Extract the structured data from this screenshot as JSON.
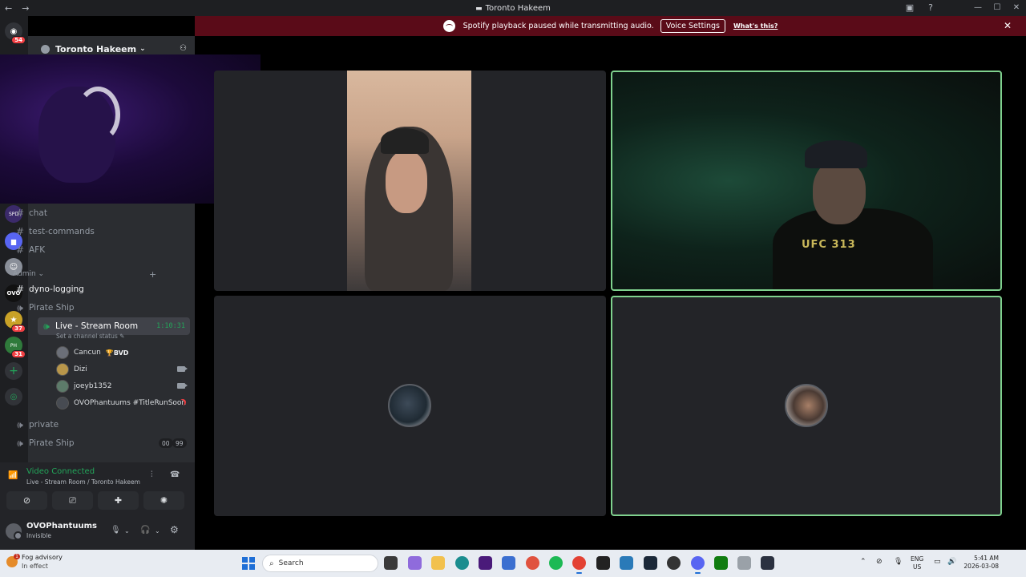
{
  "window": {
    "title": "Toronto Hakeem",
    "controls": [
      "—",
      "☐",
      "✕"
    ]
  },
  "banner": {
    "message": "Spotify playback paused while transmitting audio.",
    "button_label": "Voice Settings",
    "link_label": "What's this?"
  },
  "rail": {
    "badges": [
      "54",
      "37",
      "31"
    ]
  },
  "server": {
    "name": "Toronto Hakeem"
  },
  "channels": {
    "text1": "chat",
    "text2": "test-commands",
    "text3": "AFK",
    "category_admin": "Admin",
    "dyno": "dyno-logging",
    "pirate1": "Pirate Ship",
    "live": "Live - Stream Room",
    "live_timer": "1:10:31",
    "live_status": "Set a channel status",
    "private": "private",
    "pirate2": "Pirate Ship",
    "pirate2_count_a": "00",
    "pirate2_count_b": "99"
  },
  "voice_users": [
    {
      "name": "Cancun",
      "tag": "🏆BVD"
    },
    {
      "name": "Dizi"
    },
    {
      "name": "joeyb1352"
    },
    {
      "name": "OVOPhantuums #TitleRunSoon"
    }
  ],
  "voice_panel": {
    "status": "Video Connected",
    "location": "Live - Stream Room / Toronto Hakeem"
  },
  "user": {
    "name": "OVOPhantuums",
    "status": "Invisible"
  },
  "video": {
    "jersey_text": "UFC 313"
  },
  "taskbar": {
    "weather_title": "Fog advisory",
    "weather_sub": "In effect",
    "weather_badge": "1",
    "search_placeholder": "Search",
    "lang_top": "ENG",
    "lang_bottom": "US",
    "time": "5:41 AM",
    "date": "2026-03-08"
  },
  "colors": {
    "banner": "#5a0b18",
    "speaking_border": "#7fd18e",
    "online_green": "#23a55a",
    "sidebar": "#2b2d31"
  }
}
